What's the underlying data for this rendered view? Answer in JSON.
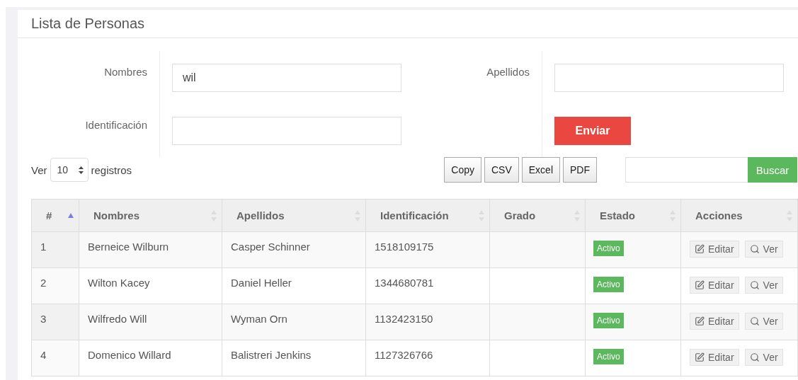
{
  "panel": {
    "title": "Lista de Personas"
  },
  "filters": {
    "fields": [
      {
        "label": "Nombres",
        "value": "wil"
      },
      {
        "label": "Apellidos"
      },
      {
        "label": "Identificación"
      }
    ],
    "submit": "Enviar"
  },
  "length_menu": {
    "prefix": "Ver",
    "value": "10",
    "suffix": "registros"
  },
  "export_buttons": [
    "Copy",
    "CSV",
    "Excel",
    "PDF"
  ],
  "search": {
    "button": "Buscar"
  },
  "table": {
    "columns": [
      {
        "label": "#",
        "sorted": true
      },
      {
        "label": "Nombres",
        "sorted": false
      },
      {
        "label": "Apellidos",
        "sorted": false
      },
      {
        "label": "Identificación",
        "sorted": false
      },
      {
        "label": "Grado",
        "sorted": false
      },
      {
        "label": "Estado",
        "sorted": false
      },
      {
        "label": "Acciones",
        "sorted": false
      }
    ],
    "rows": [
      {
        "num": "1",
        "nombres": "Berneice Wilburn",
        "apellidos": "Casper Schinner",
        "identificacion": "1518109175",
        "estado": {
          "label": "Activo",
          "color": "#5cb85c"
        },
        "actions": [
          "Editar",
          "Ver"
        ]
      },
      {
        "num": "2",
        "nombres": "Wilton Kacey",
        "apellidos": "Daniel Heller",
        "identificacion": "1344680781",
        "estado": {
          "label": "Activo",
          "color": "#5cb85c"
        },
        "actions": [
          "Editar",
          "Ver"
        ]
      },
      {
        "num": "3",
        "nombres": "Wilfredo Will",
        "apellidos": "Wyman Orn",
        "identificacion": "1132423150",
        "estado": {
          "label": "Activo",
          "color": "#5cb85c"
        },
        "actions": [
          "Editar",
          "Ver"
        ]
      },
      {
        "num": "4",
        "nombres": "Domenico Willard",
        "apellidos": "Balistreri Jenkins",
        "identificacion": "1127326766",
        "estado": {
          "label": "Activo",
          "color": "#5cb85c"
        },
        "actions": [
          "Editar",
          "Ver"
        ]
      }
    ]
  }
}
